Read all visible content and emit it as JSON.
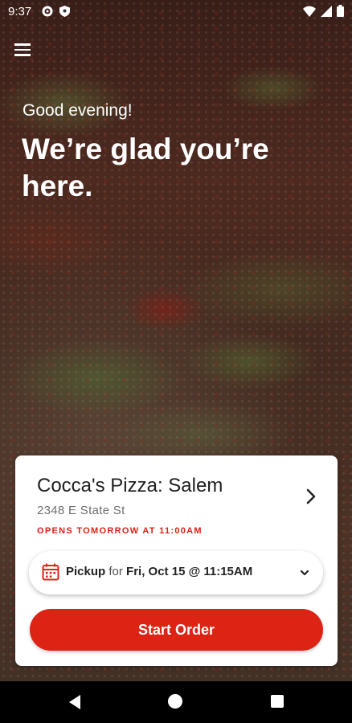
{
  "status_bar": {
    "time": "9:37",
    "left_icons": [
      "gear-icon",
      "shield-icon"
    ],
    "right_icons": [
      "wifi-icon",
      "signal-icon",
      "battery-icon"
    ]
  },
  "header": {
    "menu_icon": "hamburger-menu-icon",
    "greeting": "Good evening!",
    "headline": "We’re glad you’re here."
  },
  "store_card": {
    "store_name": "Cocca's Pizza: Salem",
    "address": "2348 E State St",
    "status": "OPENS TOMORROW AT 11:00AM",
    "pickup": {
      "icon": "calendar-icon",
      "mode": "Pickup",
      "connector": "for",
      "datetime": "Fri, Oct 15 @ 11:15AM"
    },
    "start_order_label": "Start Order"
  },
  "colors": {
    "accent": "#dd2314",
    "status_text": "#d92316"
  },
  "nav_bar": {
    "buttons": [
      "back-icon",
      "home-icon",
      "recents-icon"
    ]
  }
}
